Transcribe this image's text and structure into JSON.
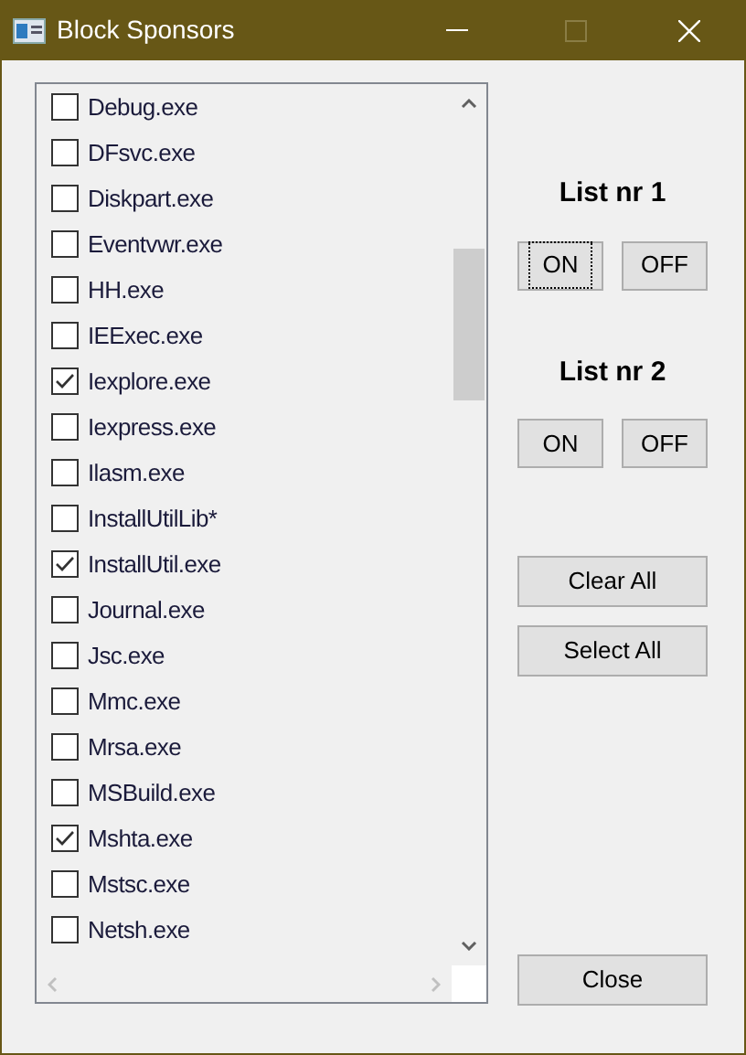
{
  "window": {
    "title": "Block Sponsors"
  },
  "items": [
    {
      "label": "Debug.exe",
      "checked": false
    },
    {
      "label": "DFsvc.exe",
      "checked": false
    },
    {
      "label": "Diskpart.exe",
      "checked": false
    },
    {
      "label": "Eventvwr.exe",
      "checked": false
    },
    {
      "label": "HH.exe",
      "checked": false
    },
    {
      "label": "IEExec.exe",
      "checked": false
    },
    {
      "label": "Iexplore.exe",
      "checked": true
    },
    {
      "label": "Iexpress.exe",
      "checked": false
    },
    {
      "label": "Ilasm.exe",
      "checked": false
    },
    {
      "label": "InstallUtilLib*",
      "checked": false
    },
    {
      "label": "InstallUtil.exe",
      "checked": true
    },
    {
      "label": "Journal.exe",
      "checked": false
    },
    {
      "label": "Jsc.exe",
      "checked": false
    },
    {
      "label": "Mmc.exe",
      "checked": false
    },
    {
      "label": "Mrsa.exe",
      "checked": false
    },
    {
      "label": "MSBuild.exe",
      "checked": false
    },
    {
      "label": "Mshta.exe",
      "checked": true
    },
    {
      "label": "Mstsc.exe",
      "checked": false
    },
    {
      "label": "Netsh.exe",
      "checked": false
    }
  ],
  "groups": [
    {
      "title": "List nr 1",
      "buttons": [
        {
          "label": "ON",
          "focused": true
        },
        {
          "label": "OFF",
          "focused": false
        }
      ]
    },
    {
      "title": "List nr 2",
      "buttons": [
        {
          "label": "ON",
          "focused": false
        },
        {
          "label": "OFF",
          "focused": false
        }
      ]
    }
  ],
  "actions": [
    {
      "label": "Clear All"
    },
    {
      "label": "Select All"
    }
  ],
  "close": {
    "label": "Close"
  }
}
